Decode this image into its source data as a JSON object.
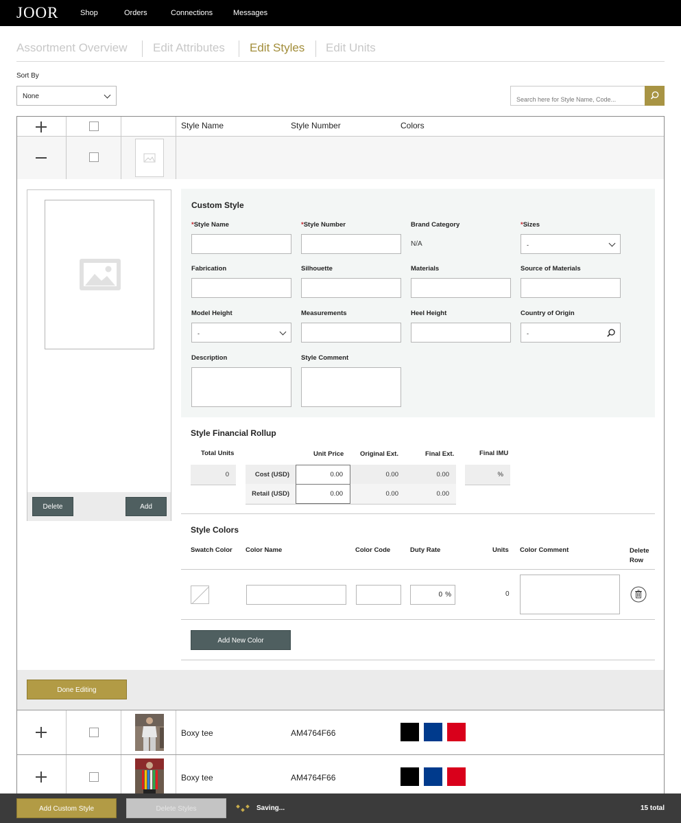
{
  "nav": {
    "logo": "JOOR",
    "links": [
      "Shop",
      "Orders",
      "Connections",
      "Messages"
    ]
  },
  "steps": [
    "Assortment Overview",
    "Edit Attributes",
    "Edit Styles",
    "Edit Units"
  ],
  "active_step": "Edit Styles",
  "sort": {
    "label": "Sort By",
    "value": "None"
  },
  "search": {
    "placeholder": "Search here for Style Name, Code..."
  },
  "table": {
    "headers": [
      "Style Name",
      "Style Number",
      "Colors"
    ]
  },
  "custom_style": {
    "title": "Custom Style",
    "fields": {
      "style_name": "Style Name",
      "style_number": "Style Number",
      "brand_category": "Brand Category",
      "brand_category_value": "N/A",
      "sizes": "Sizes",
      "sizes_value": "-",
      "fabrication": "Fabrication",
      "silhouette": "Silhouette",
      "materials": "Materials",
      "source_of_materials": "Source of Materials",
      "model_height": "Model Height",
      "model_height_value": "-",
      "measurements": "Measurements",
      "heel_height": "Heel Height",
      "country_of_origin": "Country of Origin",
      "country_of_origin_value": "-",
      "description": "Description",
      "style_comment": "Style Comment"
    },
    "required_mark": "*"
  },
  "image_panel": {
    "delete_label": "Delete",
    "add_label": "Add"
  },
  "financial": {
    "title": "Style Financial Rollup",
    "total_units_label": "Total Units",
    "total_units_value": "0",
    "headers": [
      "Unit Price",
      "Original Ext.",
      "Final Ext."
    ],
    "final_imu_label": "Final IMU",
    "final_imu_value": "%",
    "rows": [
      {
        "label": "Cost (USD)",
        "unit_price": "0.00",
        "original_ext": "0.00",
        "final_ext": "0.00"
      },
      {
        "label": "Retail (USD)",
        "unit_price": "0.00",
        "original_ext": "0.00",
        "final_ext": "0.00"
      }
    ]
  },
  "style_colors": {
    "title": "Style Colors",
    "headers": {
      "swatch": "Swatch Color",
      "name": "Color Name",
      "code": "Color Code",
      "duty": "Duty Rate",
      "units": "Units",
      "comment": "Color Comment",
      "delete_1": "Delete",
      "delete_2": "Row"
    },
    "row": {
      "duty_value": "0",
      "duty_unit": "%",
      "units": "0"
    },
    "add_label": "Add New Color"
  },
  "done_label": "Done Editing",
  "products": [
    {
      "name": "Boxy tee",
      "number": "AM4764F66",
      "colors": [
        "#000000",
        "#003a8c",
        "#d9001b"
      ]
    },
    {
      "name": "Boxy tee",
      "number": "AM4764F66",
      "colors": [
        "#000000",
        "#003a8c",
        "#d9001b"
      ]
    }
  ],
  "bottom": {
    "add_label": "Add Custom Style",
    "delete_label": "Delete Styles",
    "status": "Saving...",
    "total": "15 total"
  },
  "theme": {
    "accent": "#a89444",
    "dark_button": "#4f5f60"
  }
}
